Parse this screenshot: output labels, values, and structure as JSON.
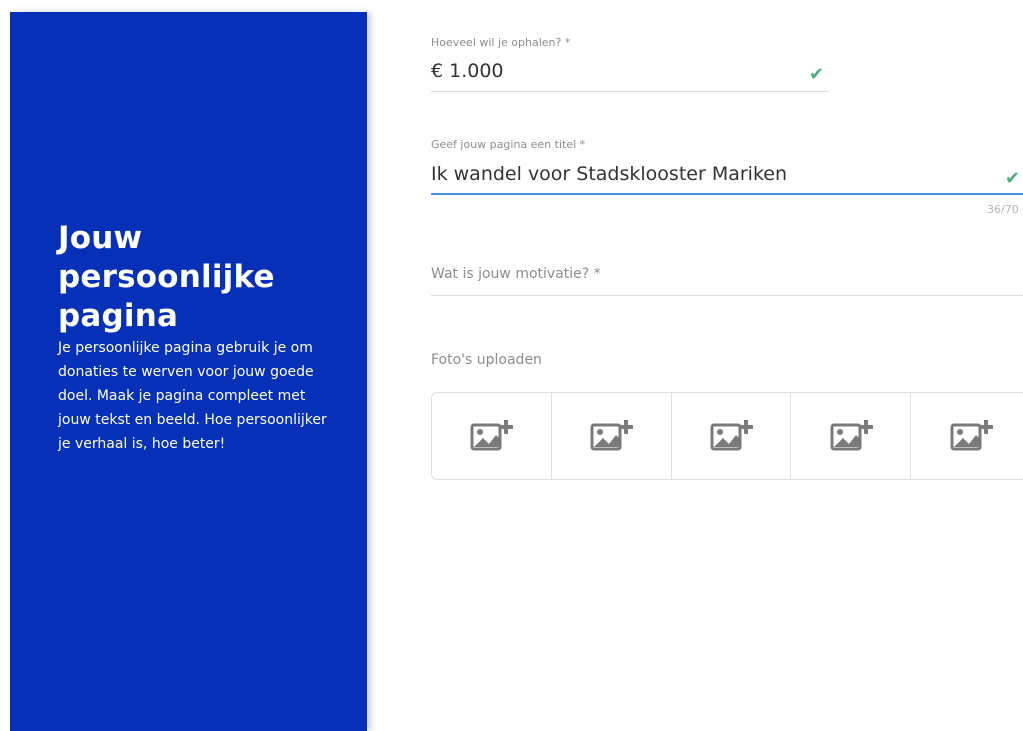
{
  "sidebar": {
    "title": "Jouw persoonlijke pagina",
    "description": "Je persoonlijke pagina gebruik je om donaties te werven voor jouw goede doel. Maak je pagina compleet met jouw tekst en beeld. Hoe persoonlijker je verhaal is, hoe beter!"
  },
  "form": {
    "amount": {
      "label": "Hoeveel wil je ophalen? *",
      "value": "€ 1.000"
    },
    "title": {
      "label": "Geef jouw pagina een titel *",
      "value": "Ik wandel voor Stadsklooster Mariken",
      "counter": "36/70"
    },
    "motivation": {
      "placeholder": "Wat is jouw motivatie? *"
    },
    "photos": {
      "label": "Foto's uploaden",
      "slots": 5
    }
  },
  "colors": {
    "sidebar": "#0630b8",
    "accent": "#4a90e2",
    "valid": "#4caf7a"
  },
  "icons": {
    "valid": "check-icon",
    "upload": "add-image-icon"
  }
}
